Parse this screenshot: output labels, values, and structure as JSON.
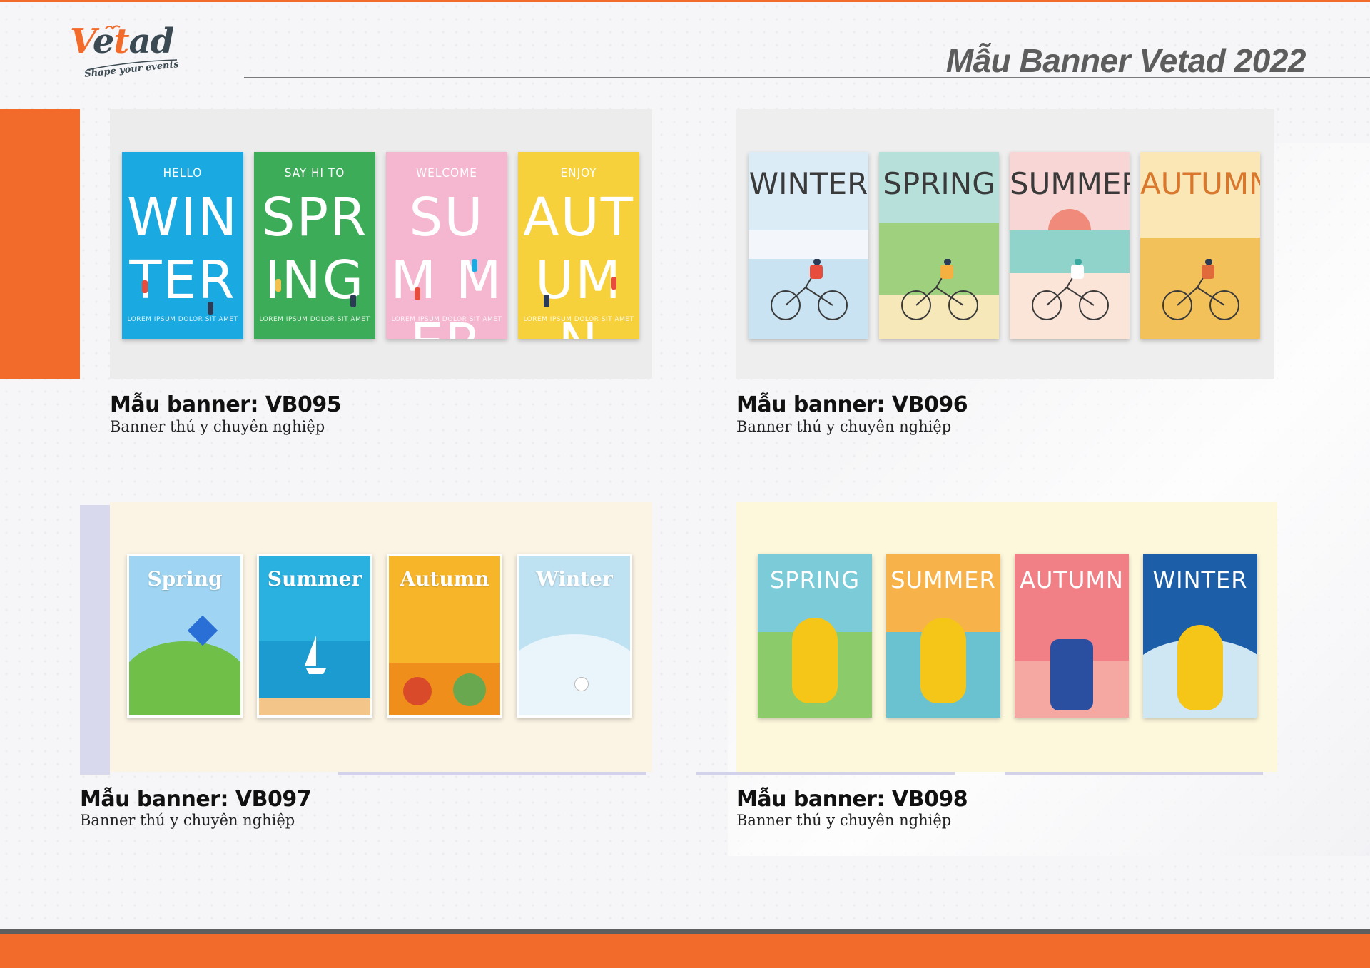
{
  "brand": {
    "logo_text_1": "V",
    "logo_text_2": "e",
    "logo_text_3": "t",
    "logo_text_4": "ad",
    "tagline": "Shape your events",
    "orange": "#f26b2b",
    "dark": "#3b4a52"
  },
  "header": {
    "title": "Mẫu Banner Vetad 2022"
  },
  "banners": [
    {
      "title": "Mẫu banner: VB095",
      "subtitle": "Banner thú y chuyên nghiệp",
      "posters": [
        {
          "small": "HELLO",
          "big": "WIN TER",
          "foot": "LOREM IPSUM DOLOR SIT AMET",
          "color": "#1aa9e0"
        },
        {
          "small": "SAY HI TO",
          "big": "SPR ING",
          "foot": "LOREM IPSUM DOLOR SIT AMET",
          "color": "#3cac58"
        },
        {
          "small": "WELCOME",
          "big": "SUM MER",
          "foot": "LOREM IPSUM DOLOR SIT AMET",
          "color": "#f5b6cf"
        },
        {
          "small": "ENJOY",
          "big": "AUT UMN",
          "foot": "LOREM IPSUM DOLOR SIT AMET",
          "color": "#f6d13b"
        }
      ]
    },
    {
      "title": "Mẫu banner: VB096",
      "subtitle": "Banner thú y chuyên nghiệp",
      "posters": [
        {
          "big": "WINTER",
          "sky": "#dcecf7",
          "ground": "#f3f7fb",
          "color": "#3a3a3a"
        },
        {
          "big": "SPRING",
          "sky": "#b8e0db",
          "ground": "#9fd07e",
          "color": "#3a3a3a"
        },
        {
          "big": "SUMMER",
          "sky": "#f9d6d6",
          "ground": "#8fd3cb",
          "color": "#3a3a3a"
        },
        {
          "big": "AUTUMN",
          "sky": "#fbe7b6",
          "ground": "#f3c15a",
          "color": "#3a3a3a"
        }
      ]
    },
    {
      "title": "Mẫu banner: VB097",
      "subtitle": "Banner thú y chuyên nghiệp",
      "posters": [
        {
          "big": "Spring",
          "sky": "#9fd5f2",
          "ground": "#6fbf48"
        },
        {
          "big": "Summer",
          "sky": "#2ab1e0",
          "ground": "#1c9bd0"
        },
        {
          "big": "Autumn",
          "sky": "#f7b62a",
          "ground": "#f08e1c"
        },
        {
          "big": "Winter",
          "sky": "#bfe2f2",
          "ground": "#e9f5fb"
        }
      ]
    },
    {
      "title": "Mẫu banner: VB098",
      "subtitle": "Banner thú y chuyên nghiệp",
      "posters": [
        {
          "big": "SPRING",
          "sky": "#7ccbd8",
          "ground": "#8ccb6a"
        },
        {
          "big": "SUMMER",
          "sky": "#f7b34a",
          "ground": "#6ac2d0"
        },
        {
          "big": "AUTUMN",
          "sky": "#f07f86",
          "ground": "#f5a7a2"
        },
        {
          "big": "WINTER",
          "sky": "#1d5ea9",
          "ground": "#cfe6f3"
        }
      ]
    }
  ]
}
